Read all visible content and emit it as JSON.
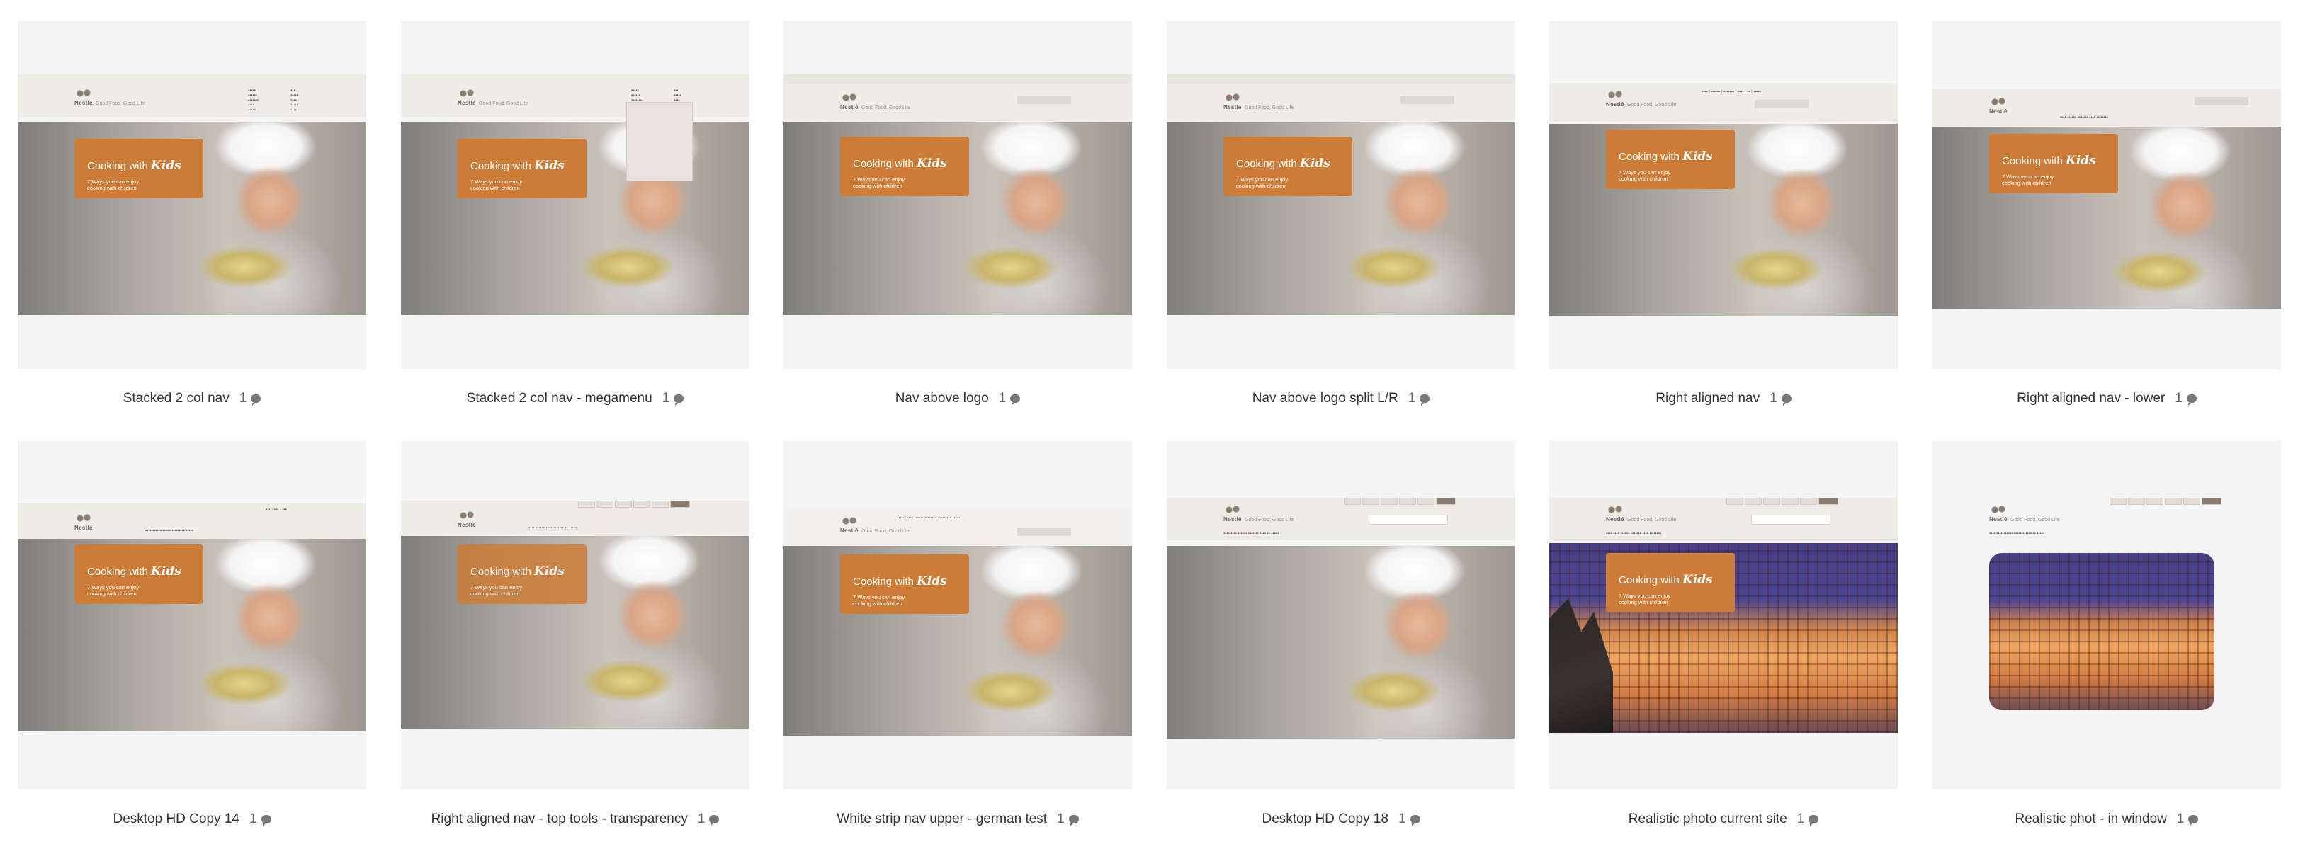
{
  "mockup": {
    "logo_word": "Nestlé",
    "tagline": "Good Food, Good Life",
    "promo_title_a": "Cooking with ",
    "promo_title_b": "Kids",
    "promo_sub": "7 Ways you can enjoy cooking with children"
  },
  "cards": [
    {
      "title": "Stacked 2 col nav",
      "comments": "1"
    },
    {
      "title": "Stacked 2 col nav - megamenu",
      "comments": "1"
    },
    {
      "title": "Nav above logo",
      "comments": "1"
    },
    {
      "title": "Nav above logo split L/R",
      "comments": "1"
    },
    {
      "title": "Right aligned nav",
      "comments": "1"
    },
    {
      "title": "Right aligned nav - lower",
      "comments": "1"
    },
    {
      "title": "Desktop HD Copy 14",
      "comments": "1"
    },
    {
      "title": "Right aligned nav - top tools - transparency",
      "comments": "1"
    },
    {
      "title": "White strip nav upper - german test",
      "comments": "1"
    },
    {
      "title": "Desktop HD Copy 18",
      "comments": "1"
    },
    {
      "title": "Realistic photo current site",
      "comments": "1"
    },
    {
      "title": "Realistic phot - in window",
      "comments": "1"
    }
  ]
}
